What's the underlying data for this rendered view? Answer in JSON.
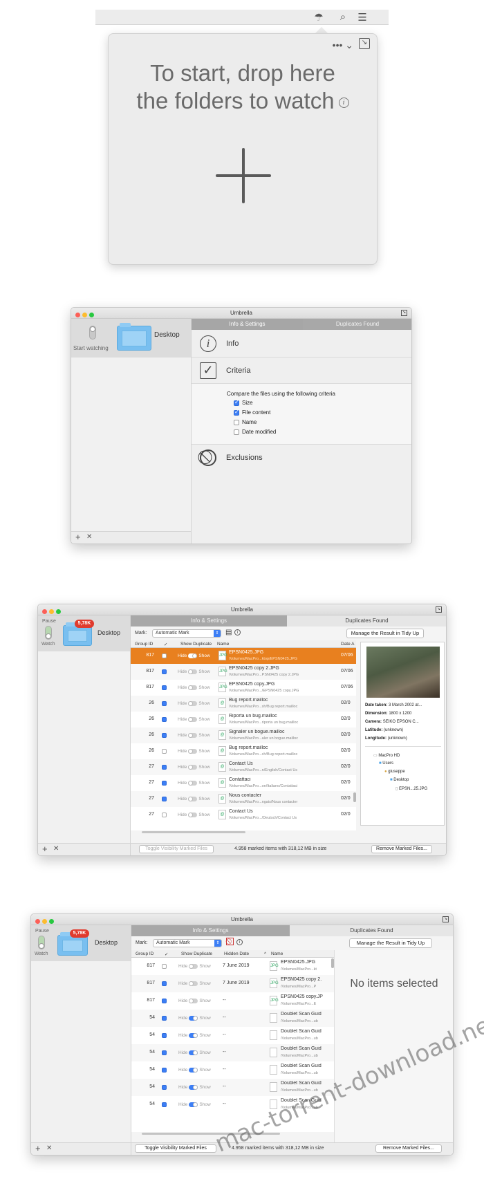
{
  "popover": {
    "drop_line1": "To start, drop here",
    "drop_line2": "the folders to watch",
    "info_glyph": "i",
    "more_glyph": "••• ⌄",
    "resize_glyph": "↘"
  },
  "menubar": {
    "icons": [
      "umbrella-icon",
      "search-icon",
      "list-icon"
    ]
  },
  "window2": {
    "title": "Umbrella",
    "tabs": [
      "Info & Settings",
      "Duplicates Found"
    ],
    "sidebar": {
      "toggle_label": "Start watching",
      "folder_name": "Desktop"
    },
    "sections": {
      "info": "Info",
      "criteria": "Criteria",
      "exclusions": "Exclusions"
    },
    "criteria_intro": "Compare the files using the following criteria",
    "criteria_options": [
      {
        "label": "Size",
        "checked": true
      },
      {
        "label": "File content",
        "checked": true
      },
      {
        "label": "Name",
        "checked": false
      },
      {
        "label": "Date modified",
        "checked": false
      }
    ],
    "bottom": {
      "add": "+",
      "remove": "✕"
    }
  },
  "window3": {
    "title": "Umbrella",
    "tabs": [
      "Info & Settings",
      "Duplicates Found"
    ],
    "sidebar": {
      "pause_label": "Pause",
      "watch_label": "Watch",
      "folder_name": "Desktop",
      "badge": "5,78K"
    },
    "toolbar": {
      "mark_label": "Mark:",
      "mark_value": "Automatic Mark",
      "manage_button": "Manage the Result in Tidy Up"
    },
    "columns": [
      "Group ID",
      "✓",
      "Show Duplicate",
      "Name",
      "Date A"
    ],
    "hide_label": "Hide",
    "show_label": "Show",
    "rows": [
      {
        "group": "817",
        "checked": false,
        "switch_on": true,
        "name": "EPSN0425.JPG",
        "path": "/Volumes/MacPro...ktop/EPSN0425.JPG",
        "date": "07/06",
        "selected": true,
        "icon": "jpg"
      },
      {
        "group": "817",
        "checked": true,
        "switch_on": false,
        "name": "EPSN0425 copy 2.JPG",
        "path": "/Volumes/MacPro...PSN0425 copy 2.JPG",
        "date": "07/06",
        "selected": false,
        "icon": "jpg"
      },
      {
        "group": "817",
        "checked": true,
        "switch_on": false,
        "name": "EPSN0425 copy.JPG",
        "path": "/Volumes/MacPro.../EPSN0425 copy.JPG",
        "date": "07/06",
        "selected": false,
        "icon": "jpg"
      },
      {
        "group": "26",
        "checked": true,
        "switch_on": false,
        "name": "Bug report.mailloc",
        "path": "/Volumes/MacPro...sh/Bug report.mailloc",
        "date": "02/0",
        "selected": false,
        "icon": "mail"
      },
      {
        "group": "26",
        "checked": true,
        "switch_on": false,
        "name": "Riporta un bug.mailloc",
        "path": "/Volumes/MacPro...riporta un bug.mailloc",
        "date": "02/0",
        "selected": false,
        "icon": "mail"
      },
      {
        "group": "26",
        "checked": true,
        "switch_on": false,
        "name": "Signaler un bogue.mailloc",
        "path": "/Volumes/MacPro...aler un bogue.mailloc",
        "date": "02/0",
        "selected": false,
        "icon": "mail"
      },
      {
        "group": "26",
        "checked": false,
        "switch_on": false,
        "name": "Bug report.mailloc",
        "path": "/Volumes/MacPro...ch/Bug report.mailloc",
        "date": "02/0",
        "selected": false,
        "icon": "mail"
      },
      {
        "group": "27",
        "checked": true,
        "switch_on": false,
        "name": "Contact Us",
        "path": "/Volumes/MacPro...n/English/Contact Us",
        "date": "02/0",
        "selected": false,
        "icon": "mail"
      },
      {
        "group": "27",
        "checked": true,
        "switch_on": false,
        "name": "Contattaci",
        "path": "/Volumes/MacPro...on/Italiano/Contattaci",
        "date": "02/0",
        "selected": false,
        "icon": "mail"
      },
      {
        "group": "27",
        "checked": true,
        "switch_on": false,
        "name": "Nous contacter",
        "path": "/Volumes/MacPro...ngais/Nous contacter",
        "date": "02/0",
        "selected": false,
        "icon": "mail"
      },
      {
        "group": "27",
        "checked": false,
        "switch_on": false,
        "name": "Contact Us",
        "path": "/Volumes/MacPro.../Deutsch/Contact Us",
        "date": "02/0",
        "selected": false,
        "icon": "mail"
      }
    ],
    "inspector": {
      "date_taken_label": "Date taken:",
      "date_taken": "3 March 2002 at...",
      "dimension_label": "Dimension:",
      "dimension": "1800 x 1200",
      "camera_label": "Camera:",
      "camera": "SEIKO EPSON C...",
      "latitude_label": "Latitude:",
      "latitude": "(unknown)",
      "longitude_label": "Longitude:",
      "longitude": "(unknown)",
      "path_items": [
        "MacPro HD",
        "Users",
        "giuseppe",
        "Desktop",
        "EPSN...25.JPG"
      ]
    },
    "bottom": {
      "toggle_button": "Toggle Visibility Marked Files",
      "status": "4.958 marked items with 318,12 MB in size",
      "remove_button": "Remove Marked Files...",
      "add": "+",
      "remove": "✕"
    }
  },
  "window4": {
    "title": "Umbrella",
    "tabs": [
      "Info & Settings",
      "Duplicates Found"
    ],
    "sidebar": {
      "pause_label": "Pause",
      "watch_label": "Watch",
      "folder_name": "Desktop",
      "badge": "5,78K"
    },
    "toolbar": {
      "mark_label": "Mark:",
      "mark_value": "Automatic Mark",
      "manage_button": "Manage the Result in Tidy Up"
    },
    "columns": [
      "Group ID",
      "✓",
      "Show Duplicate",
      "Hidden Date",
      "Name"
    ],
    "sort_glyph": "^",
    "hide_label": "Hide",
    "show_label": "Show",
    "rows": [
      {
        "group": "817",
        "checked": false,
        "switch_on": false,
        "hidden_date": "7 June 2019",
        "name": "EPSN0425.JPG",
        "path": "/Volumes/MacPro...kt",
        "icon": "jpg"
      },
      {
        "group": "817",
        "checked": true,
        "switch_on": false,
        "hidden_date": "7 June 2019",
        "name": "EPSN0425 copy 2.",
        "path": "/Volumes/MacPro...P",
        "icon": "jpg"
      },
      {
        "group": "817",
        "checked": true,
        "switch_on": false,
        "hidden_date": "--",
        "name": "EPSN0425 copy.JP",
        "path": "/Volumes/MacPro...E",
        "icon": "jpg"
      },
      {
        "group": "54",
        "checked": true,
        "switch_on": true,
        "hidden_date": "--",
        "name": "Doublet Scan Guid",
        "path": "/Volumes/MacPro...ub",
        "icon": "doc"
      },
      {
        "group": "54",
        "checked": true,
        "switch_on": true,
        "hidden_date": "--",
        "name": "Doublet Scan Guid",
        "path": "/Volumes/MacPro...ub",
        "icon": "doc"
      },
      {
        "group": "54",
        "checked": true,
        "switch_on": true,
        "hidden_date": "--",
        "name": "Doublet Scan Guid",
        "path": "/Volumes/MacPro...ub",
        "icon": "doc"
      },
      {
        "group": "54",
        "checked": true,
        "switch_on": true,
        "hidden_date": "--",
        "name": "Doublet Scan Guid",
        "path": "/Volumes/MacPro...ub",
        "icon": "doc"
      },
      {
        "group": "54",
        "checked": true,
        "switch_on": true,
        "hidden_date": "--",
        "name": "Doublet Scan Guid",
        "path": "/Volumes/MacPro...ub",
        "icon": "doc"
      },
      {
        "group": "54",
        "checked": true,
        "switch_on": true,
        "hidden_date": "--",
        "name": "Doublet Scan Guid",
        "path": "/Volumes/MacPro...ub",
        "icon": "doc"
      }
    ],
    "no_items": "No items selected",
    "bottom": {
      "toggle_button": "Toggle Visibility Marked Files",
      "status": "4.958 marked items with 318,12 MB in size",
      "remove_button": "Remove Marked Files...",
      "add": "+",
      "remove": "✕"
    }
  },
  "watermark": "mac-torrent-download.net",
  "colors": {
    "accent": "#3c7ef5",
    "selection": "#e8801f",
    "badge": "#e03b2e",
    "folder": "#79bff0"
  }
}
